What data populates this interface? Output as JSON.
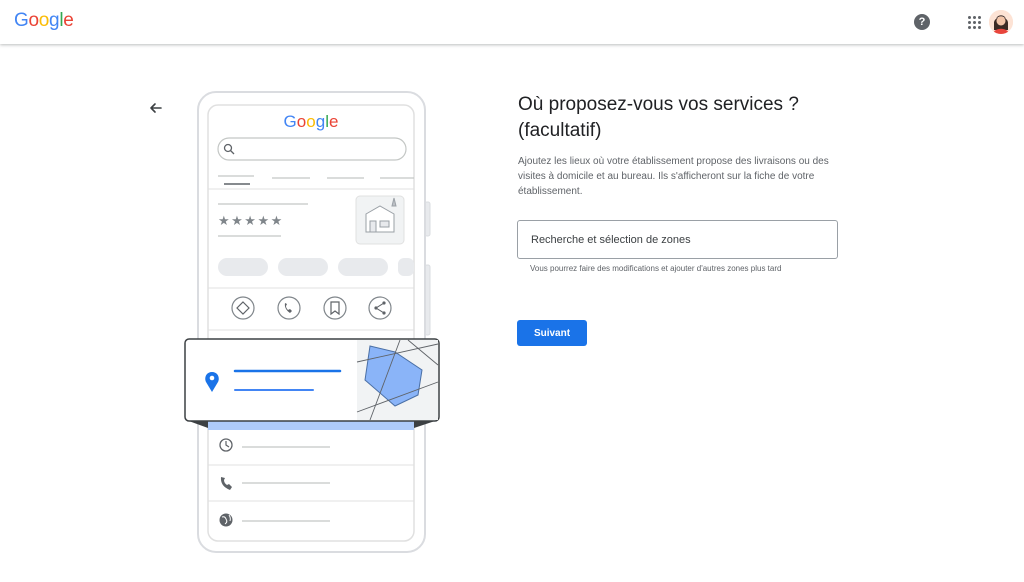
{
  "header": {
    "logo_letters": [
      {
        "char": "G",
        "color": "#4285F4"
      },
      {
        "char": "o",
        "color": "#EA4335"
      },
      {
        "char": "o",
        "color": "#FBBC05"
      },
      {
        "char": "g",
        "color": "#4285F4"
      },
      {
        "char": "l",
        "color": "#34A853"
      },
      {
        "char": "e",
        "color": "#EA4335"
      }
    ],
    "help_icon": "question-circle-icon",
    "apps_icon": "apps-grid-icon",
    "avatar_icon": "account-avatar-icon"
  },
  "illustration": {
    "logo_text": "Google",
    "rating_stars": "★★★★★",
    "icons": [
      "search-icon",
      "storefront-icon",
      "directions-icon",
      "phone-icon",
      "bookmark-icon",
      "share-icon",
      "location-pin-icon",
      "clock-icon",
      "phone-icon",
      "globe-icon"
    ],
    "accent": "#4285F4",
    "map_fill": "#8ab4f8"
  },
  "main": {
    "back_icon": "arrow-back-icon",
    "title": "Où proposez-vous vos services ? (facultatif)",
    "description": "Ajoutez les lieux où votre établissement propose des livraisons ou des visites à domicile et au bureau. Ils s'afficheront sur la fiche de votre établissement.",
    "search_placeholder": "Recherche et sélection de zones",
    "hint": "Vous pourrez faire des modifications et ajouter d'autres zones plus tard",
    "next_label": "Suivant",
    "primary_color": "#1a73e8"
  }
}
